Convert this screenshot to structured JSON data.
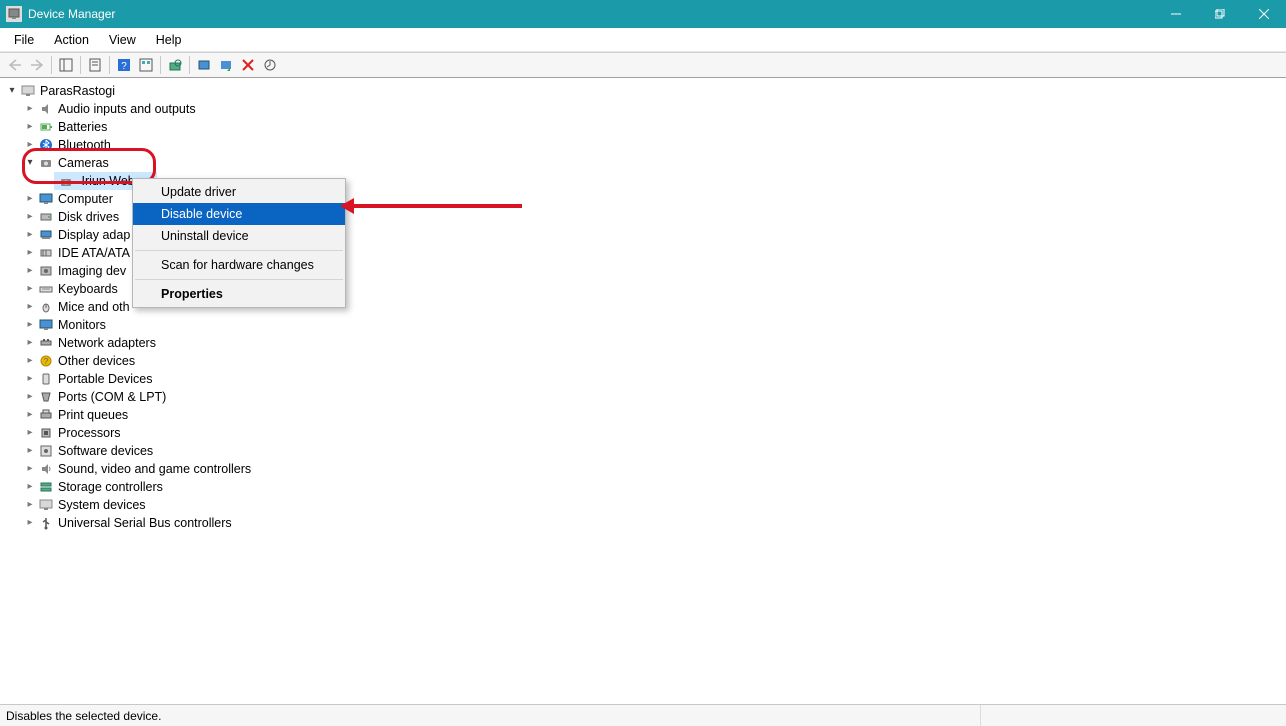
{
  "window": {
    "title": "Device Manager"
  },
  "menu": {
    "file": "File",
    "action": "Action",
    "view": "View",
    "help": "Help"
  },
  "tree": {
    "root": "ParasRastogi",
    "audio": "Audio inputs and outputs",
    "batteries": "Batteries",
    "bluetooth": "Bluetooth",
    "cameras": "Cameras",
    "camera_item": "Iriun Web",
    "computer": "Computer",
    "disk": "Disk drives",
    "display": "Display adap",
    "ide": "IDE ATA/ATA",
    "imaging": "Imaging dev",
    "keyboards": "Keyboards",
    "mice": "Mice and oth",
    "monitors": "Monitors",
    "network": "Network adapters",
    "other": "Other devices",
    "portable": "Portable Devices",
    "ports": "Ports (COM & LPT)",
    "printq": "Print queues",
    "processors": "Processors",
    "software": "Software devices",
    "sound": "Sound, video and game controllers",
    "storage": "Storage controllers",
    "system": "System devices",
    "usb": "Universal Serial Bus controllers"
  },
  "context_menu": {
    "update": "Update driver",
    "disable": "Disable device",
    "uninstall": "Uninstall device",
    "scan": "Scan for hardware changes",
    "properties": "Properties"
  },
  "statusbar": {
    "text": "Disables the selected device."
  }
}
